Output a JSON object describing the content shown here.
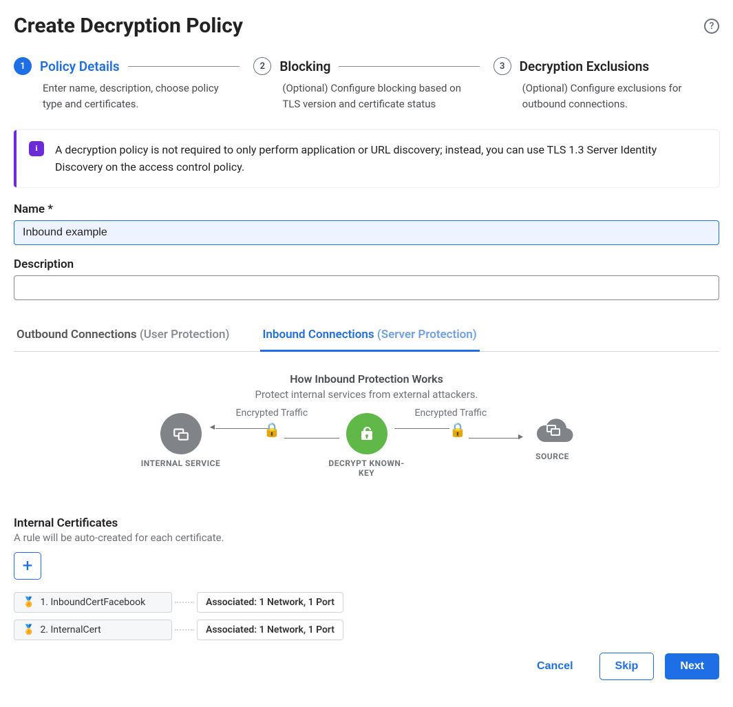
{
  "page_title": "Create Decryption Policy",
  "steps": [
    {
      "num": "1",
      "title": "Policy Details",
      "desc": "Enter name, description, choose policy type and certificates.",
      "active": true
    },
    {
      "num": "2",
      "title": "Blocking",
      "desc": "(Optional) Configure blocking based on TLS version and certificate status",
      "active": false
    },
    {
      "num": "3",
      "title": "Decryption Exclusions",
      "desc": "(Optional) Configure exclusions for outbound connections.",
      "active": false
    }
  ],
  "alert": "A decryption policy is not required to only perform application or URL discovery; instead, you can use TLS 1.3 Server Identity Discovery on the access control policy.",
  "form": {
    "name_label": "Name *",
    "name_value": "Inbound example",
    "desc_label": "Description",
    "desc_value": ""
  },
  "tabs": {
    "outbound": {
      "main": "Outbound Connections",
      "muted": "(User Protection)"
    },
    "inbound": {
      "main": "Inbound Connections",
      "muted": "(Server Protection)"
    }
  },
  "how": {
    "title": "How Inbound Protection Works",
    "subtitle": "Protect internal services from external attackers.",
    "left_label": "INTERNAL SERVICE",
    "mid_label": "DECRYPT KNOWN-KEY",
    "right_label": "SOURCE",
    "enc_left": "Encrypted Traffic",
    "enc_right": "Encrypted Traffic"
  },
  "certs": {
    "section_title": "Internal Certificates",
    "section_sub": "A rule will be auto-created for each certificate.",
    "rows": [
      {
        "name": "1. InboundCertFacebook",
        "assoc": "Associated: 1 Network, 1 Port"
      },
      {
        "name": "2. InternalCert",
        "assoc": "Associated: 1 Network, 1 Port"
      }
    ]
  },
  "footer": {
    "cancel": "Cancel",
    "skip": "Skip",
    "next": "Next"
  }
}
